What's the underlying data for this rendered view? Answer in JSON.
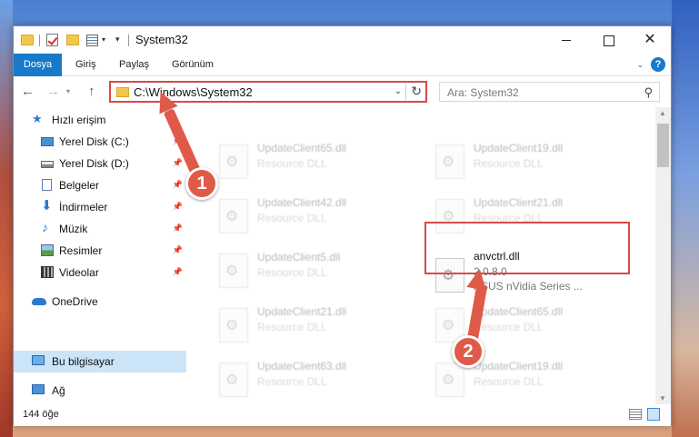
{
  "window": {
    "title": "System32"
  },
  "ribbon": {
    "tabs": [
      "Dosya",
      "Giriş",
      "Paylaş",
      "Görünüm"
    ],
    "help": "?"
  },
  "nav": {
    "address": "C:\\Windows\\System32",
    "search_placeholder": "Ara: System32"
  },
  "sidebar": {
    "items": [
      {
        "label": "Hızlı erişim",
        "icon": "star-icon"
      },
      {
        "label": "Yerel Disk (C:)",
        "icon": "disk-icon"
      },
      {
        "label": "Yerel Disk (D:)",
        "icon": "disk-icon"
      },
      {
        "label": "Belgeler",
        "icon": "documents-icon"
      },
      {
        "label": "İndirmeler",
        "icon": "download-icon"
      },
      {
        "label": "Müzik",
        "icon": "music-icon"
      },
      {
        "label": "Resimler",
        "icon": "pictures-icon"
      },
      {
        "label": "Videolar",
        "icon": "videos-icon"
      },
      {
        "label": "OneDrive",
        "icon": "cloud-icon"
      },
      {
        "label": "Bu bilgisayar",
        "icon": "computer-icon"
      },
      {
        "label": "Ağ",
        "icon": "network-icon"
      }
    ]
  },
  "files": [
    {
      "name": "UpdateClient65.dll",
      "desc": "Resource DLL"
    },
    {
      "name": "UpdateClient19.dll",
      "desc": "Resource DLL"
    },
    {
      "name": "UpdateClient42.dll",
      "desc": "Resource DLL"
    },
    {
      "name": "UpdateClient21.dll",
      "desc": "Resource DLL"
    },
    {
      "name": "UpdateClient5.dll",
      "desc": "Resource DLL"
    },
    {
      "name": "anvctrl.dll",
      "version": "2.0.8.0",
      "desc": "ASUS nVidia Series ..."
    },
    {
      "name": "UpdateClient21.dll",
      "desc": "Resource DLL"
    },
    {
      "name": "UpdateClient65.dll",
      "desc": "Resource DLL"
    },
    {
      "name": "UpdateClient63.dll",
      "desc": "Resource DLL"
    },
    {
      "name": "UpdateClient19.dll",
      "desc": "Resource DLL"
    }
  ],
  "status": {
    "count": "144 öğe"
  },
  "annotations": {
    "step1": "1",
    "step2": "2",
    "color": "#e05a4a"
  }
}
